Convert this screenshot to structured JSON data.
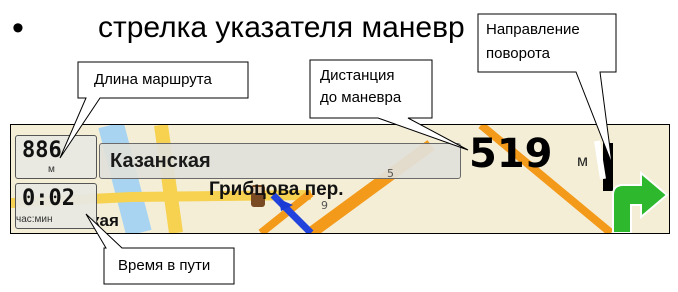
{
  "slide": {
    "bullet": "•",
    "text": "стрелка указателя маневр"
  },
  "navbar": {
    "street_name": "Казанская",
    "route_length": {
      "value": "886",
      "unit": "м"
    },
    "travel_time": {
      "value": "0:02",
      "unit": "час:мин"
    },
    "maneuver_distance": {
      "value": "519",
      "unit": "м"
    },
    "map_labels": {
      "street": "Грибцова пер.",
      "fragment": "кая",
      "house_5": "5",
      "house_9": "9"
    },
    "colors": {
      "arrow": "#2eb82e",
      "road_yellow": "#f6d250",
      "road_orange": "#f49a1a",
      "river": "#a8d4f2",
      "route": "#2244dd"
    }
  },
  "callouts": {
    "route_length": "Длина маршрута",
    "maneuver_distance": [
      "Дистанция",
      "до маневра"
    ],
    "turn_direction": [
      "Направление",
      "поворота"
    ],
    "travel_time": "Время в пути"
  }
}
